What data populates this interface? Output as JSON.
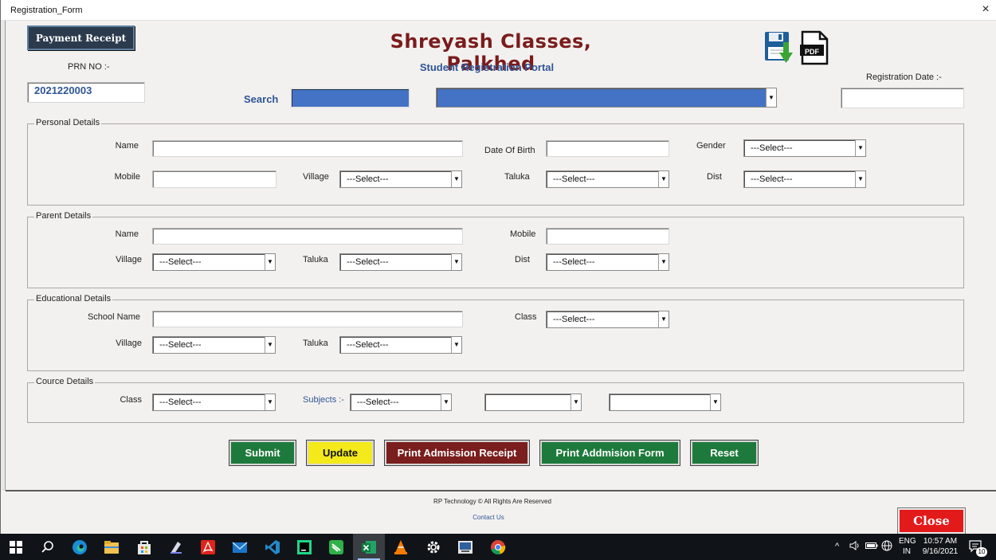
{
  "window": {
    "title": "Registration_Form",
    "close_glyph": "×"
  },
  "header": {
    "payment_receipt_label": "Payment Receipt",
    "title": "Shreyash Classes, Palkhed",
    "subtitle": "Student Registration Portal",
    "prn_label": "PRN NO :-",
    "prn_value": "2021220003",
    "search_label": "Search",
    "registration_date_label": "Registration Date :-",
    "registration_date_value": ""
  },
  "personal": {
    "legend": "Personal Details",
    "name_label": "Name",
    "dob_label": "Date Of Birth",
    "gender_label": "Gender",
    "gender_value": "---Select---",
    "mobile_label": "Mobile",
    "village_label": "Village",
    "village_value": "---Select---",
    "taluka_label": "Taluka",
    "taluka_value": "---Select---",
    "dist_label": "Dist",
    "dist_value": "---Select---"
  },
  "parent": {
    "legend": "Parent Details",
    "name_label": "Name",
    "mobile_label": "Mobile",
    "village_label": "Village",
    "village_value": "---Select---",
    "taluka_label": "Taluka",
    "taluka_value": "---Select---",
    "dist_label": "Dist",
    "dist_value": "---Select---"
  },
  "education": {
    "legend": "Educational Details",
    "school_label": "School Name",
    "class_label": "Class",
    "class_value": "---Select---",
    "village_label": "Village",
    "village_value": "---Select---",
    "taluka_label": "Taluka",
    "taluka_value": "---Select---"
  },
  "course": {
    "legend": "Cource Details",
    "class_label": "Class",
    "class_value": "---Select---",
    "subjects_label": "Subjects :-",
    "subject1_value": "---Select---",
    "subject2_value": "",
    "subject3_value": ""
  },
  "actions": {
    "submit": "Submit",
    "update": "Update",
    "print_receipt": "Print Admission Receipt",
    "print_form": "Print Addmision Form",
    "reset": "Reset"
  },
  "footer": {
    "copyright": "RP Technology © All Rights Are Reserved",
    "contact": "Contact Us",
    "close": "Close"
  },
  "icons": {
    "save": "save-download-icon",
    "pdf_label": "PDF"
  },
  "taskbar": {
    "lang_top": "ENG",
    "lang_bottom": "IN",
    "time": "10:57 AM",
    "date": "9/16/2021",
    "notification_count": "10"
  },
  "colors": {
    "brand_title": "#7a1c1c",
    "accent_blue": "#2f5597",
    "green": "#1e7a3c",
    "yellow": "#f4ea1b",
    "maroon": "#7a1e1e",
    "close_red": "#e31a1a"
  }
}
